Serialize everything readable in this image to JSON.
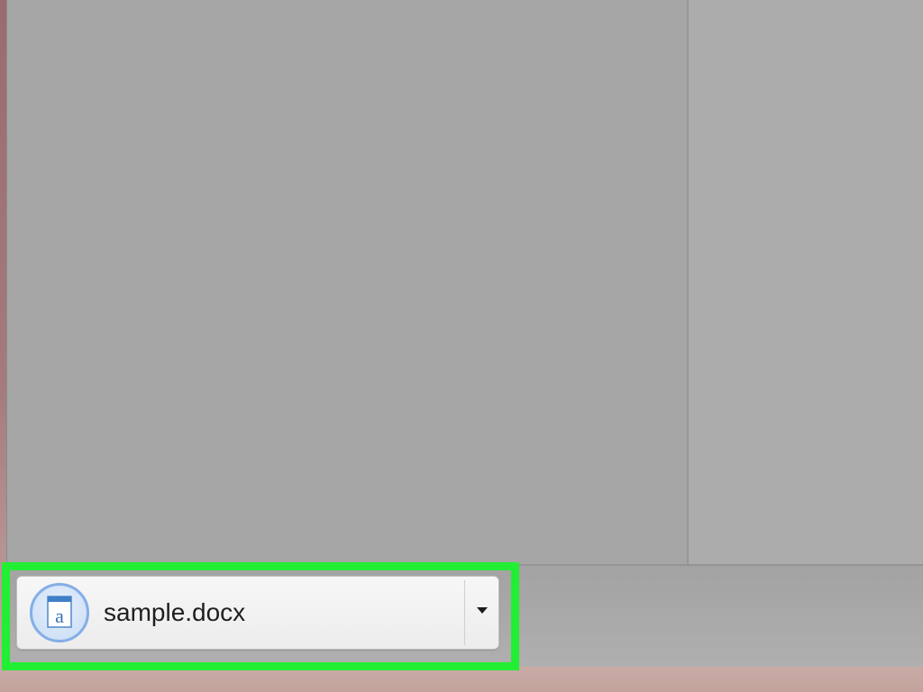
{
  "download_shelf": {
    "items": [
      {
        "file_name": "sample.docx",
        "file_icon": "document-a-icon",
        "menu_icon": "caret-down-icon"
      }
    ]
  },
  "colors": {
    "highlight": "#22ee33",
    "window_gray": "#a7a7a7",
    "icon_ring": "#84aee6"
  }
}
